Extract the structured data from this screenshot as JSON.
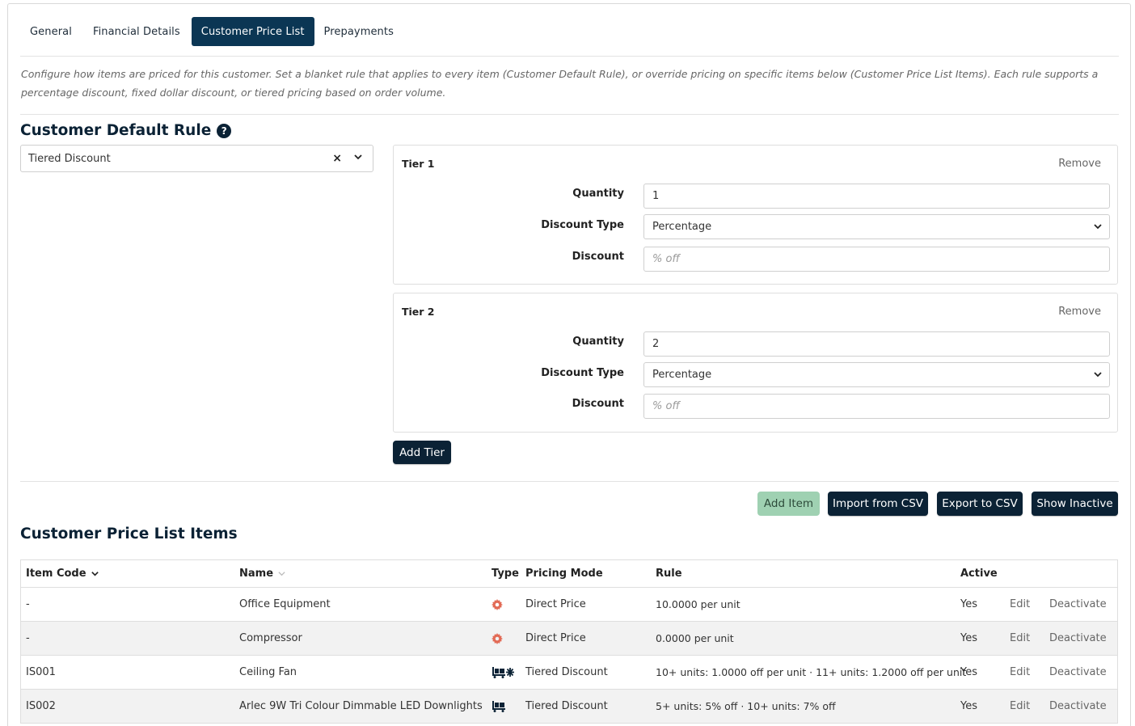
{
  "tabs": [
    {
      "label": "General"
    },
    {
      "label": "Financial Details"
    },
    {
      "label": "Customer Price List"
    },
    {
      "label": "Prepayments"
    }
  ],
  "description": "Configure how items are priced for this customer. Set a blanket rule that applies to every item (Customer Default Rule), or override pricing on specific items below (Customer Price List Items). Each rule supports a percentage discount, fixed dollar discount, or tiered pricing based on order volume.",
  "default_rule": {
    "title": "Customer Default Rule",
    "help_glyph": "?",
    "selected": "Tiered Discount",
    "clear_glyph": "×",
    "tiers": [
      {
        "title": "Tier 1",
        "remove_label": "Remove",
        "quantity_label": "Quantity",
        "quantity": "1",
        "discount_type_label": "Discount Type",
        "discount_type": "Percentage",
        "discount_label": "Discount",
        "discount_placeholder": "% off"
      },
      {
        "title": "Tier 2",
        "remove_label": "Remove",
        "quantity_label": "Quantity",
        "quantity": "2",
        "discount_type_label": "Discount Type",
        "discount_type": "Percentage",
        "discount_label": "Discount",
        "discount_placeholder": "% off"
      }
    ],
    "add_tier_label": "Add Tier"
  },
  "toolbar": {
    "add_item": "Add Item",
    "import_csv": "Import from CSV",
    "export_csv": "Export to CSV",
    "show_inactive": "Show Inactive"
  },
  "items": {
    "title": "Customer Price List Items",
    "columns": {
      "item_code": "Item Code",
      "name": "Name",
      "type": "Type",
      "pricing_mode": "Pricing Mode",
      "rule": "Rule",
      "active": "Active"
    },
    "rows": [
      {
        "item_code": "-",
        "name": "Office Equipment",
        "type_icon": "gear-icon",
        "pricing_mode": "Direct Price",
        "rule": "10.0000 per unit",
        "active": "Yes",
        "edit": "Edit",
        "deactivate": "Deactivate"
      },
      {
        "item_code": "-",
        "name": "Compressor",
        "type_icon": "gear-icon",
        "pricing_mode": "Direct Price",
        "rule": "0.0000 per unit",
        "active": "Yes",
        "edit": "Edit",
        "deactivate": "Deactivate"
      },
      {
        "item_code": "IS001",
        "name": "Ceiling Fan",
        "type_icon": "stock-item-variant-icon",
        "pricing_mode": "Tiered Discount",
        "rule": "10+ units: 1.0000 off per unit · 11+ units: 1.2000 off per unit",
        "active": "Yes",
        "edit": "Edit",
        "deactivate": "Deactivate"
      },
      {
        "item_code": "IS002",
        "name": "Arlec 9W Tri Colour Dimmable LED Downlights",
        "type_icon": "stock-item-icon",
        "pricing_mode": "Tiered Discount",
        "rule": "5+ units: 5% off · 10+ units: 7% off",
        "active": "Yes",
        "edit": "Edit",
        "deactivate": "Deactivate"
      }
    ]
  },
  "colors": {
    "primary": "#0b2235",
    "active_tab": "#0b3654",
    "add_item_bg": "#9fd1b2",
    "gear": "#e26a55"
  }
}
